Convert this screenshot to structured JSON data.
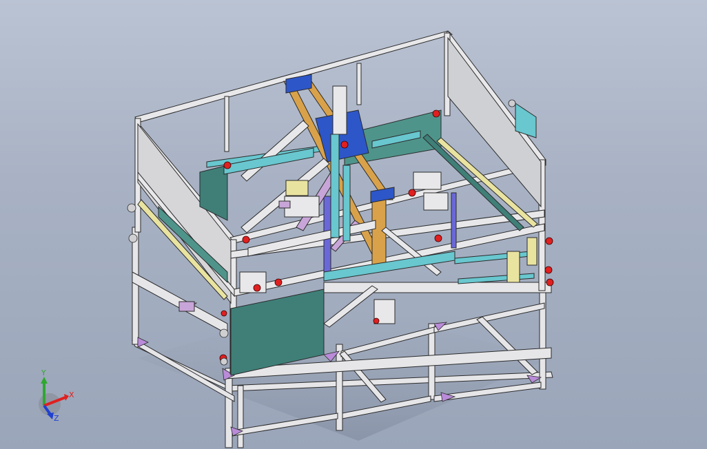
{
  "viewport": {
    "background_top": "#bac3d3",
    "background_bottom": "#9aa5b9"
  },
  "colors": {
    "frame": "#e8e8ea",
    "frame_edge": "#2a2a2a",
    "panel_teal": "#3f7f78",
    "panel_teal_light": "#4f948b",
    "beam_orange": "#d9a24a",
    "beam_blue": "#2d56c8",
    "cyan": "#68c7cf",
    "red": "#e02020",
    "purple": "#b98bd8",
    "yellow": "#e9e3a0",
    "lavender": "#c8a5d8"
  },
  "triad": {
    "x_label": "X",
    "y_label": "Y",
    "z_label": "Z",
    "x_color": "#e02020",
    "y_color": "#2fa82f",
    "z_color": "#2040d0"
  }
}
